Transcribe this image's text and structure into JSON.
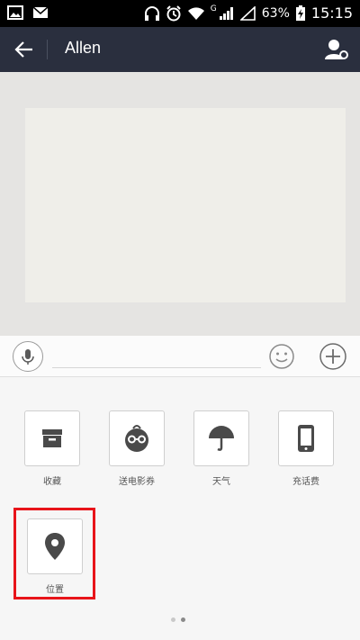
{
  "status_bar": {
    "battery": "63%",
    "time": "15:15",
    "network": "G"
  },
  "header": {
    "title": "Allen"
  },
  "input_bar": {
    "value": "",
    "placeholder": ""
  },
  "panel": {
    "items": [
      {
        "label": "收藏",
        "icon": "archive-box-icon"
      },
      {
        "label": "送电影券",
        "icon": "movie-ticket-face-icon"
      },
      {
        "label": "天气",
        "icon": "umbrella-icon"
      },
      {
        "label": "充话费",
        "icon": "phone-icon"
      },
      {
        "label": "位置",
        "icon": "location-pin-icon"
      }
    ],
    "page_count": 2,
    "active_page": 2
  },
  "colors": {
    "nav_bg": "#2a2f3e",
    "status_bg": "#000000",
    "highlight": "#e8141a",
    "icon_dark": "#4a4a4a"
  }
}
